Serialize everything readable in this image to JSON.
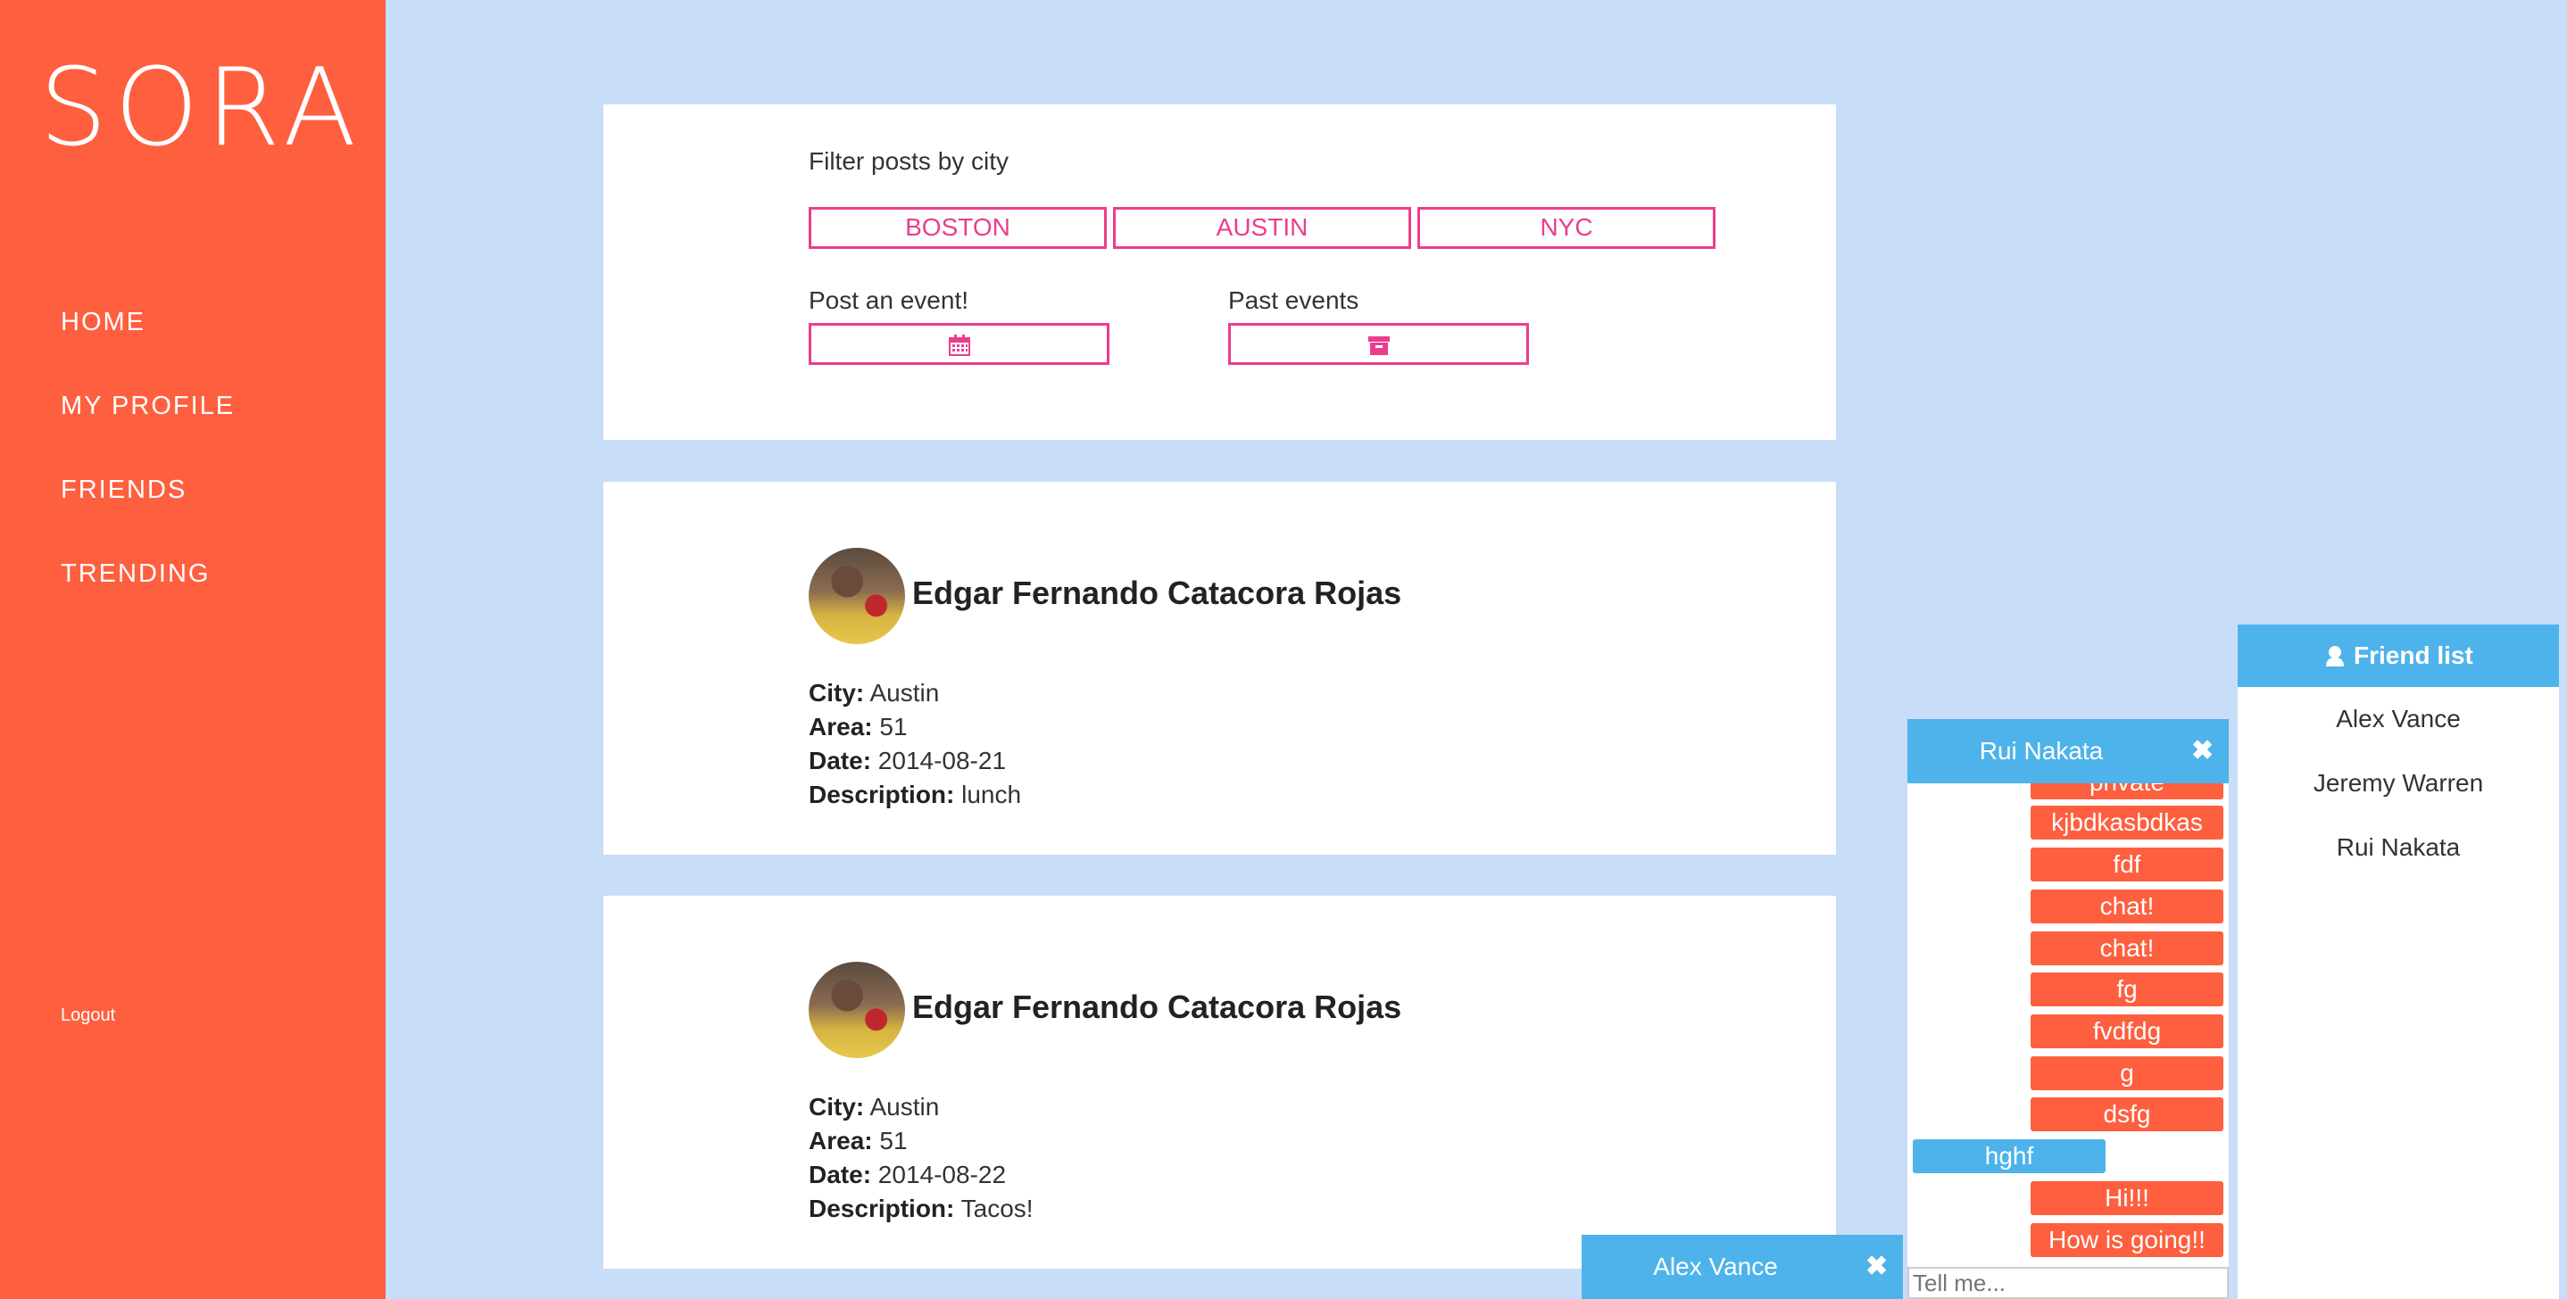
{
  "app": {
    "logo": "SORA"
  },
  "sidebar": {
    "items": [
      {
        "label": "HOME"
      },
      {
        "label": "MY PROFILE"
      },
      {
        "label": "FRIENDS"
      },
      {
        "label": "TRENDING"
      }
    ],
    "logout": "Logout"
  },
  "filter": {
    "title": "Filter posts by city",
    "cities": [
      "BOSTON",
      "AUSTIN",
      "NYC"
    ],
    "post_event_label": "Post an event!",
    "past_events_label": "Past events",
    "post_event_icon": "calendar-icon",
    "past_events_icon": "archive-icon"
  },
  "posts": [
    {
      "author": "Edgar Fernando Catacora Rojas",
      "city_label": "City:",
      "city": "Austin",
      "area_label": "Area:",
      "area": "51",
      "date_label": "Date:",
      "date": "2014-08-21",
      "desc_label": "Description:",
      "description": "lunch"
    },
    {
      "author": "Edgar Fernando Catacora Rojas",
      "city_label": "City:",
      "city": "Austin",
      "area_label": "Area:",
      "area": "51",
      "date_label": "Date:",
      "date": "2014-08-22",
      "desc_label": "Description:",
      "description": "Tacos!"
    }
  ],
  "chat": {
    "title": "Rui Nakata",
    "messages": [
      {
        "text": "private",
        "from": "me"
      },
      {
        "text": "kjbdkasbdkas",
        "from": "me"
      },
      {
        "text": "fdf",
        "from": "me"
      },
      {
        "text": "chat!",
        "from": "me"
      },
      {
        "text": "chat!",
        "from": "me"
      },
      {
        "text": "fg",
        "from": "me"
      },
      {
        "text": "fvdfdg",
        "from": "me"
      },
      {
        "text": "g",
        "from": "me"
      },
      {
        "text": "dsfg",
        "from": "me"
      },
      {
        "text": "hghf",
        "from": "them"
      },
      {
        "text": "Hi!!!",
        "from": "me"
      },
      {
        "text": "How is going!!",
        "from": "me"
      }
    ],
    "input_placeholder": "Tell me..."
  },
  "chat2": {
    "title": "Alex Vance"
  },
  "friend_list": {
    "title": "Friend list",
    "friends": [
      "Alex Vance",
      "Jeremy Warren",
      "Rui Nakata"
    ]
  },
  "colors": {
    "sidebar": "#fe5f3f",
    "accent": "#ec3d8c",
    "chat_header": "#4db3ea",
    "background": "#c8ddf8"
  }
}
